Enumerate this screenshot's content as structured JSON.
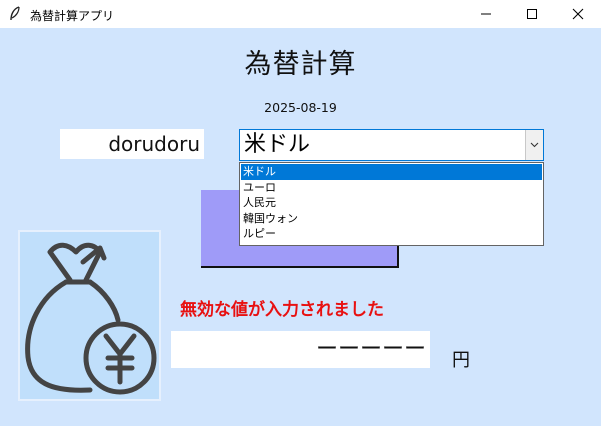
{
  "window": {
    "title": "為替計算アプリ",
    "icon": "feather-icon",
    "controls": [
      "minimize-icon",
      "maximize-icon",
      "close-icon"
    ]
  },
  "main": {
    "title": "為替計算",
    "date": "2025-08-19",
    "amount_input": "dorudoru",
    "currency_select": {
      "value": "米ドル",
      "options": [
        "米ドル",
        "ユーロ",
        "人民元",
        "韓国ウォン",
        "ルピー"
      ],
      "selected_index": 0
    },
    "calculate_button_label": "",
    "error_message": "無効な値が入力されました",
    "result_value": "ーーーーー",
    "result_unit": "円"
  },
  "colors": {
    "background": "#d1e5fd",
    "button": "#9f9bf8",
    "error": "#e81111",
    "selection": "#0078d7"
  }
}
